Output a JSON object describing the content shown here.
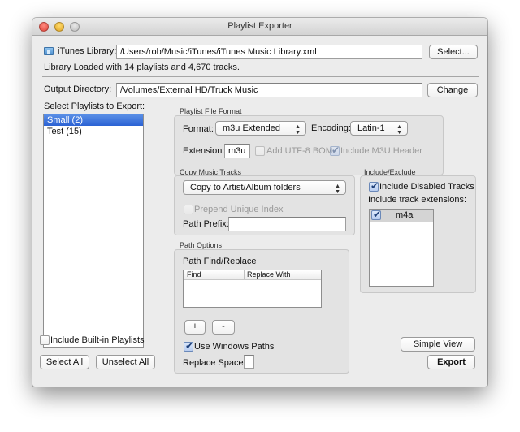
{
  "window": {
    "title": "Playlist Exporter"
  },
  "library": {
    "icon": "itunes-folder-icon",
    "label": "iTunes Library:",
    "path": "/Users/rob/Music/iTunes/iTunes Music Library.xml",
    "select_button": "Select...",
    "status": "Library Loaded with 14 playlists and 4,670 tracks."
  },
  "output": {
    "label": "Output Directory:",
    "path": "/Volumes/External HD/Truck Music",
    "change_button": "Change"
  },
  "playlists": {
    "label": "Select Playlists to Export:",
    "items": [
      {
        "label": "Small (2)",
        "selected": true
      },
      {
        "label": "Test (15)",
        "selected": false
      }
    ],
    "include_builtin": {
      "label": "Include Built-in Playlists",
      "checked": false
    },
    "select_all_button": "Select All",
    "unselect_all_button": "Unselect All"
  },
  "file_format": {
    "group_title": "Playlist File Format",
    "format_label": "Format:",
    "format_value": "m3u Extended",
    "encoding_label": "Encoding:",
    "encoding_value": "Latin-1",
    "extension_label": "Extension:",
    "extension_value": "m3u",
    "add_bom": {
      "label": "Add UTF-8 BOM",
      "checked": false,
      "enabled": false
    },
    "include_header": {
      "label": "Include M3U Header",
      "checked": true,
      "enabled": false
    }
  },
  "copy_tracks": {
    "group_title": "Copy Music Tracks",
    "mode_value": "Copy to Artist/Album folders",
    "prepend_index": {
      "label": "Prepend Unique Index",
      "checked": false,
      "enabled": false
    },
    "path_prefix_label": "Path Prefix:",
    "path_prefix_value": ""
  },
  "include_exclude": {
    "group_title": "Include/Exclude",
    "include_disabled": {
      "label": "Include Disabled Tracks",
      "checked": true
    },
    "extensions_label": "Include track extensions:",
    "extensions": [
      {
        "label": "m4a",
        "checked": true
      }
    ]
  },
  "path_options": {
    "group_title": "Path Options",
    "find_replace_label": "Path Find/Replace",
    "columns": [
      "Find",
      "Replace With"
    ],
    "rows": [],
    "add_button": "+",
    "remove_button": "-",
    "use_windows_paths": {
      "label": "Use Windows Paths",
      "checked": true
    },
    "replace_spaces_label": "Replace Spaces:",
    "replace_spaces_value": ""
  },
  "actions": {
    "simple_view_button": "Simple View",
    "export_button": "Export"
  }
}
